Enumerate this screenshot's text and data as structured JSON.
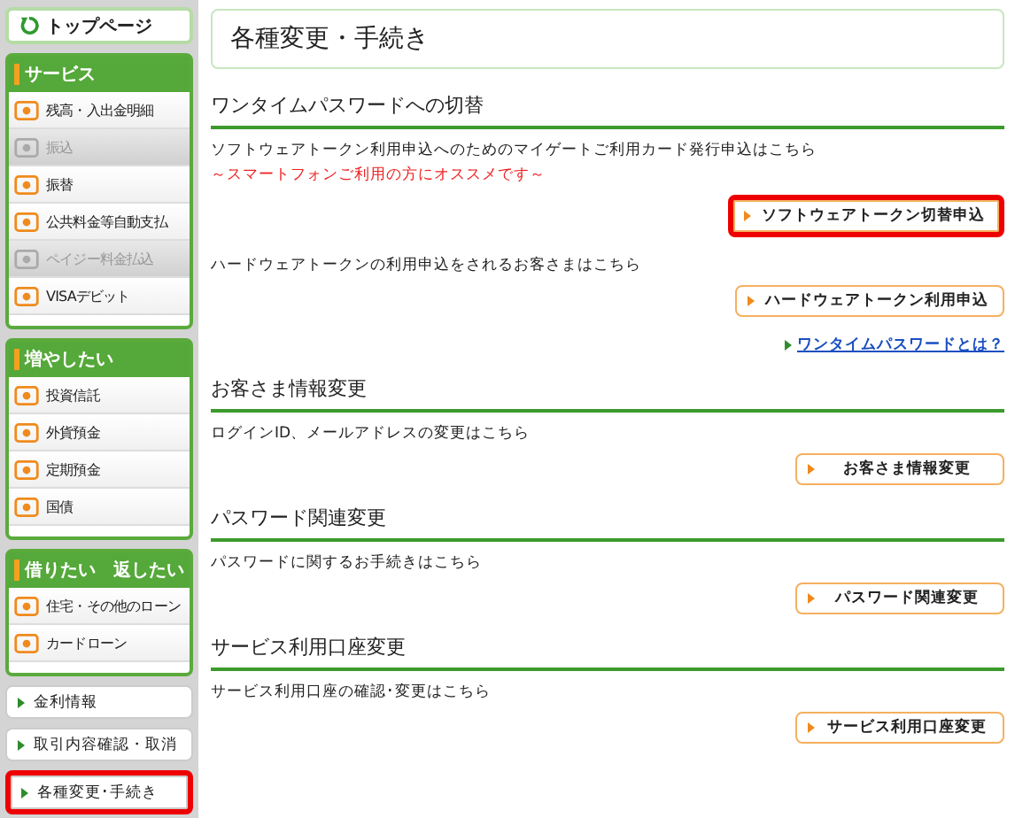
{
  "sidebar": {
    "top_button": "トップページ",
    "groups": [
      {
        "title": "サービス",
        "items": [
          {
            "label": "残高・入出金明細",
            "disabled": false
          },
          {
            "label": "振込",
            "disabled": true
          },
          {
            "label": "振替",
            "disabled": false
          },
          {
            "label": "公共料金等自動支払",
            "disabled": false
          },
          {
            "label": "ペイジー料金払込",
            "disabled": true
          },
          {
            "label": "VISAデビット",
            "disabled": false
          }
        ]
      },
      {
        "title": "増やしたい",
        "items": [
          {
            "label": "投資信託",
            "disabled": false
          },
          {
            "label": "外貨預金",
            "disabled": false
          },
          {
            "label": "定期預金",
            "disabled": false
          },
          {
            "label": "国債",
            "disabled": false
          }
        ]
      },
      {
        "title": "借りたい　返したい",
        "items": [
          {
            "label": "住宅・その他のローン",
            "disabled": false
          },
          {
            "label": "カードローン",
            "disabled": false
          }
        ]
      }
    ],
    "links": [
      {
        "label": "金利情報",
        "highlighted": false
      },
      {
        "label": "取引内容確認・取消",
        "highlighted": false
      },
      {
        "label": "各種変更･手続き",
        "highlighted": true
      }
    ]
  },
  "main": {
    "title": "各種変更・手続き",
    "sections": [
      {
        "heading": "ワンタイムパスワードへの切替",
        "blocks": [
          {
            "kind": "text",
            "text": "ソフトウェアトークン利用申込へのためのマイゲートご利用カード発行申込はこちら"
          },
          {
            "kind": "note",
            "text": "～スマートフォンご利用の方にオススメです～"
          },
          {
            "kind": "button",
            "label": "ソフトウェアトークン切替申込",
            "highlighted": true
          },
          {
            "kind": "text",
            "text": "ハードウェアトークンの利用申込をされるお客さまはこちら"
          },
          {
            "kind": "button",
            "label": "ハードウェアトークン利用申込",
            "highlighted": false
          },
          {
            "kind": "link",
            "text": "ワンタイムパスワードとは？"
          }
        ]
      },
      {
        "heading": "お客さま情報変更",
        "blocks": [
          {
            "kind": "text",
            "text": "ログインID、メールアドレスの変更はこちら"
          },
          {
            "kind": "button",
            "label": "お客さま情報変更",
            "highlighted": false
          }
        ]
      },
      {
        "heading": "パスワード関連変更",
        "blocks": [
          {
            "kind": "text",
            "text": "パスワードに関するお手続きはこちら"
          },
          {
            "kind": "button",
            "label": "パスワード関連変更",
            "highlighted": false
          }
        ]
      },
      {
        "heading": "サービス利用口座変更",
        "blocks": [
          {
            "kind": "text",
            "text": "サービス利用口座の確認･変更はこちら"
          },
          {
            "kind": "button",
            "label": "サービス利用口座変更",
            "highlighted": false
          }
        ]
      }
    ]
  }
}
